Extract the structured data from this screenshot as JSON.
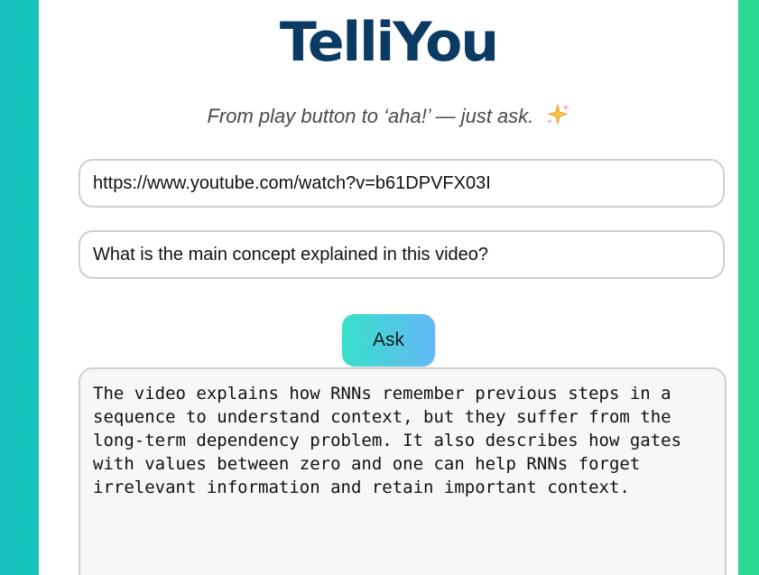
{
  "app": {
    "brand": "TelliYou",
    "tagline": "From play button to ‘aha!’ — just ask.",
    "sparkle_icon": "sparkles-icon",
    "colors": {
      "brand": "#0b3a63",
      "button_gradient_start": "#36e0c9",
      "button_gradient_end": "#64b8f7",
      "background_start": "#16c3c0",
      "background_end": "#2ad994"
    }
  },
  "form": {
    "url_value": "https://www.youtube.com/watch?v=b61DPVFX03I",
    "question_value": "What is the main concept explained in this video?",
    "ask_label": "Ask"
  },
  "answer": {
    "text": "The video explains how RNNs remember previous steps in a sequence to understand context, but they suffer from the long-term dependency problem. It also describes how gates with values between zero and one can help RNNs forget irrelevant information and retain important context."
  }
}
